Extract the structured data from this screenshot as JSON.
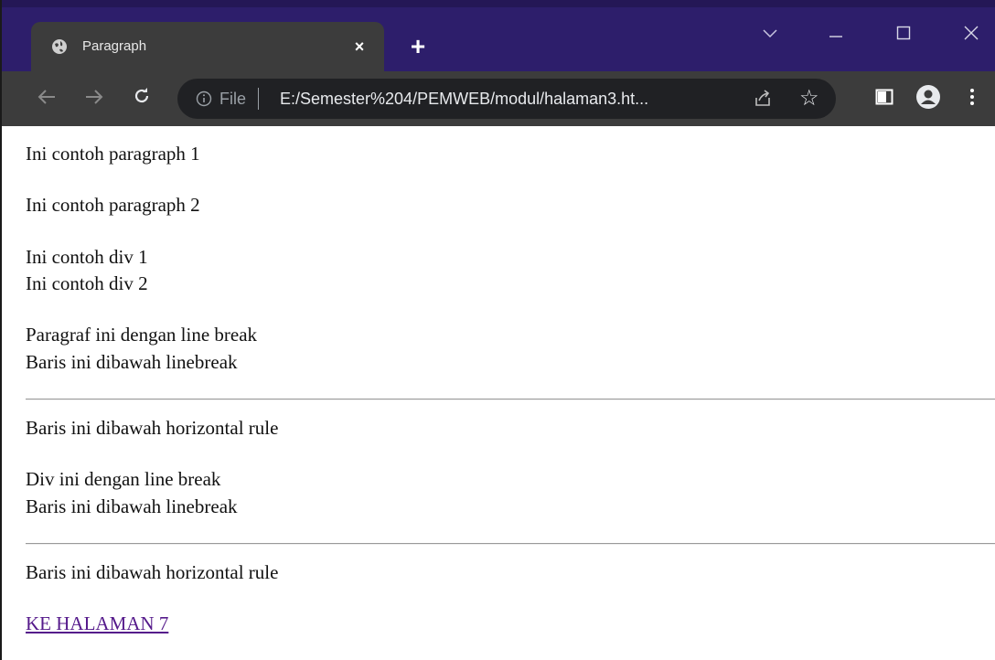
{
  "browser": {
    "tab_title": "Paragraph",
    "tab_close": "×",
    "new_tab": "+",
    "address": {
      "scheme_label": "File",
      "url": "E:/Semester%204/PEMWEB/modul/halaman3.ht..."
    },
    "icons": {
      "tab_favicon": "globe-icon",
      "back": "arrow-left-icon",
      "forward": "arrow-right-icon",
      "reload": "reload-icon",
      "info": "info-icon",
      "share": "share-icon",
      "bookmark": "star-icon",
      "side_panel": "side-panel-icon",
      "profile": "profile-icon",
      "menu": "kebab-menu-icon",
      "tab_search": "chevron-down-icon",
      "minimize": "minimize-icon",
      "maximize": "maximize-icon",
      "close": "close-icon"
    },
    "colors": {
      "titlebar": "#2d1e6b",
      "toolbar": "#3c3c3c",
      "omnibox": "#202124",
      "link_visited": "#551a8b"
    }
  },
  "page": {
    "p1": "Ini contoh paragraph 1",
    "p2": "Ini contoh paragraph 2",
    "div1": "Ini contoh div 1",
    "div2": "Ini contoh div 2",
    "br_para_line1": "Paragraf ini dengan line break",
    "br_para_line2": "Baris ini dibawah linebreak",
    "after_hr_1": "Baris ini dibawah horizontal rule",
    "br_div_line1": "Div ini dengan line break",
    "br_div_line2": "Baris ini dibawah linebreak",
    "after_hr_2": "Baris ini dibawah horizontal rule",
    "link_text": "KE HALAMAN 7"
  }
}
